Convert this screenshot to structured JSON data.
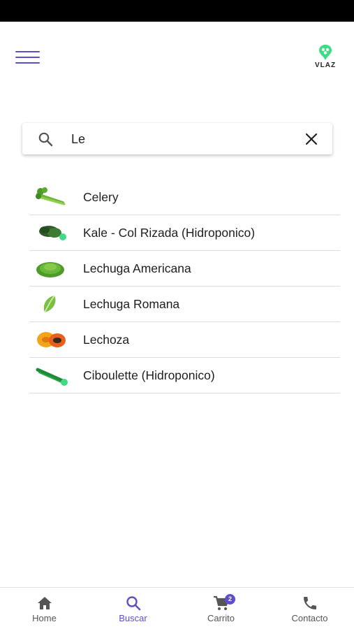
{
  "header": {
    "brand_text": "VLAZ"
  },
  "search": {
    "value": "Le",
    "placeholder": ""
  },
  "results": [
    {
      "name": "Celery",
      "icon": "celery-image"
    },
    {
      "name": "Kale - Col Rizada (Hidroponico)",
      "icon": "kale-image"
    },
    {
      "name": "Lechuga Americana",
      "icon": "lettuce-image"
    },
    {
      "name": "Lechuga Romana",
      "icon": "romaine-image"
    },
    {
      "name": "Lechoza",
      "icon": "papaya-image"
    },
    {
      "name": "Ciboulette (Hidroponico)",
      "icon": "chives-image"
    }
  ],
  "bottom_nav": {
    "items": [
      {
        "label": "Home",
        "icon": "home-icon",
        "active": false
      },
      {
        "label": "Buscar",
        "icon": "search-icon",
        "active": true
      },
      {
        "label": "Carrito",
        "icon": "cart-icon",
        "active": false,
        "badge": "2"
      },
      {
        "label": "Contacto",
        "icon": "phone-icon",
        "active": false
      }
    ]
  },
  "colors": {
    "accent": "#5b4fc7",
    "logo_green": "#3ddc84"
  }
}
